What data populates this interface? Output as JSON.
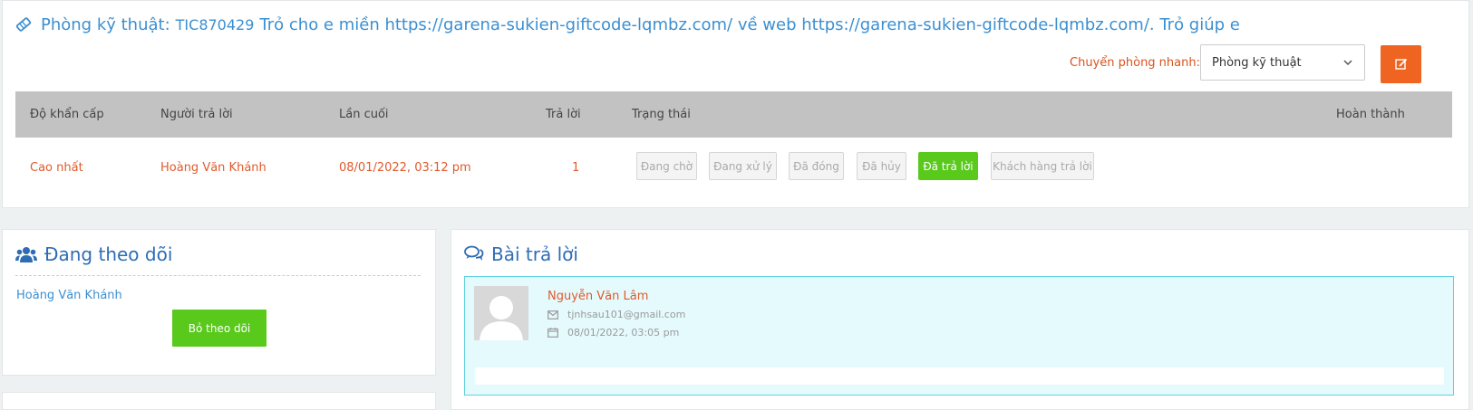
{
  "ticket": {
    "dept_label": "Phòng kỹ thuật:",
    "code": "TIC870429",
    "subject": "Trỏ cho e miền https://garena-sukien-giftcode-lqmbz.com/ về web https://garena-sukien-giftcode-lqmbz.com/. Trỏ giúp e",
    "quick_move_label": "Chuyển phòng nhanh:",
    "dept_select_value": "Phòng kỹ thuật",
    "icons": {
      "title": "tag-icon",
      "edit": "edit-icon",
      "select": "chevron-down-icon"
    },
    "accent_color": "#ee6420"
  },
  "table": {
    "headers": [
      "Độ khẩn cấp",
      "Người trả lời",
      "Lần cuối",
      "Trả lời",
      "Trạng thái",
      "Hoàn thành"
    ],
    "row": {
      "priority": "Cao nhất",
      "responder": "Hoàng Văn Khánh",
      "last": "08/01/2022, 03:12 pm",
      "replies": "1"
    },
    "statuses": [
      "Đang chờ",
      "Đang xử lý",
      "Đã đóng",
      "Đã hủy",
      "Đã trả lời",
      "Khách hàng trả lời"
    ],
    "active_status": "Đã trả lời",
    "active_color": "#59c91c"
  },
  "following": {
    "title": "Đang theo dõi",
    "icon": "users-icon",
    "follower": "Hoàng Văn Khánh",
    "unfollow_label": "Bỏ theo dõi"
  },
  "replies": {
    "title": "Bài trả lời",
    "icon": "comments-icon",
    "items": [
      {
        "name": "Nguyễn Văn Lâm",
        "email": "tjnhsau101@gmail.com",
        "date": "08/01/2022, 03:05 pm"
      }
    ]
  }
}
